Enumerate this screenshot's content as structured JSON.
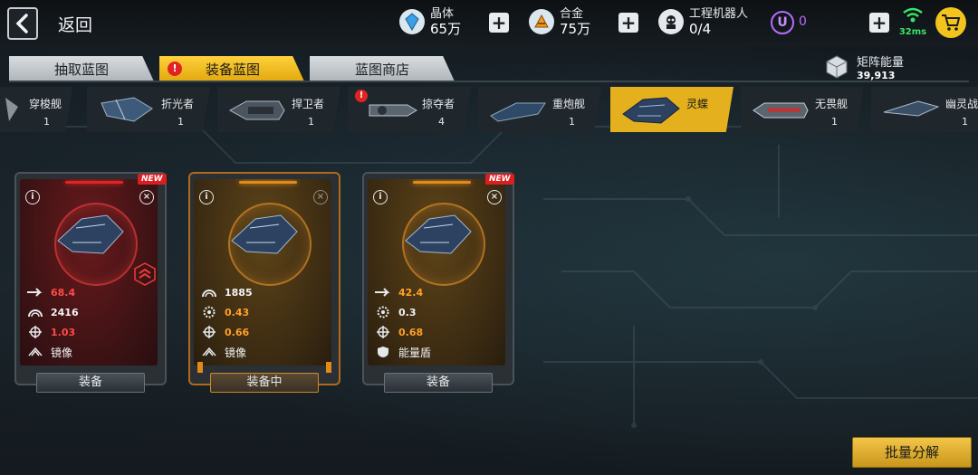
{
  "header": {
    "back_label": "返回",
    "resources": [
      {
        "name": "晶体",
        "value": "65万",
        "icon": "crystal-icon"
      },
      {
        "name": "合金",
        "value": "75万",
        "icon": "alloy-icon"
      },
      {
        "name": "工程机器人",
        "value": "0/4",
        "icon": "robot-icon"
      }
    ],
    "u_currency": "0",
    "ping": "32ms"
  },
  "tabs": [
    {
      "label": "抽取蓝图",
      "active": false,
      "alert": false
    },
    {
      "label": "装备蓝图",
      "active": true,
      "alert": true
    },
    {
      "label": "蓝图商店",
      "active": false,
      "alert": false
    }
  ],
  "matrix": {
    "name": "矩阵能量",
    "value": "39,913"
  },
  "ships": [
    {
      "name": "穿梭舰",
      "count": "1",
      "alert": false,
      "active": false
    },
    {
      "name": "折光者",
      "count": "1",
      "alert": false,
      "active": false
    },
    {
      "name": "捍卫者",
      "count": "1",
      "alert": false,
      "active": false
    },
    {
      "name": "掠夺者",
      "count": "4",
      "alert": true,
      "active": false
    },
    {
      "name": "重炮舰",
      "count": "1",
      "alert": false,
      "active": false
    },
    {
      "name": "灵蝶",
      "count": "",
      "alert": false,
      "active": true
    },
    {
      "name": "无畏舰",
      "count": "1",
      "alert": false,
      "active": false
    },
    {
      "name": "幽灵战",
      "count": "1",
      "alert": false,
      "active": false
    }
  ],
  "cards": [
    {
      "theme": "red",
      "new": "NEW",
      "equipped": false,
      "stats": [
        {
          "icon": "speed-icon",
          "value": "68.4",
          "color": "red"
        },
        {
          "icon": "armor-icon",
          "value": "2416",
          "color": "white"
        },
        {
          "icon": "target-icon",
          "value": "1.03",
          "color": "red"
        }
      ],
      "skill": "镜像",
      "button": "装备"
    },
    {
      "theme": "gold",
      "new": "",
      "equipped": true,
      "stats": [
        {
          "icon": "armor-icon",
          "value": "1885",
          "color": "white"
        },
        {
          "icon": "gear-icon",
          "value": "0.43",
          "color": "orange"
        },
        {
          "icon": "target-icon",
          "value": "0.66",
          "color": "orange"
        }
      ],
      "skill": "镜像",
      "button": "装备中"
    },
    {
      "theme": "gold",
      "new": "NEW",
      "equipped": false,
      "stats": [
        {
          "icon": "speed-icon",
          "value": "42.4",
          "color": "orange"
        },
        {
          "icon": "gear-icon",
          "value": "0.3",
          "color": "white"
        },
        {
          "icon": "target-icon",
          "value": "0.68",
          "color": "orange"
        }
      ],
      "skill": "能量盾",
      "button": "装备"
    }
  ],
  "batch_button": "批量分解",
  "colors": {
    "accent": "#e4b01d",
    "alert": "#e02424",
    "ping": "#39e36a",
    "u": "#b66cff"
  }
}
